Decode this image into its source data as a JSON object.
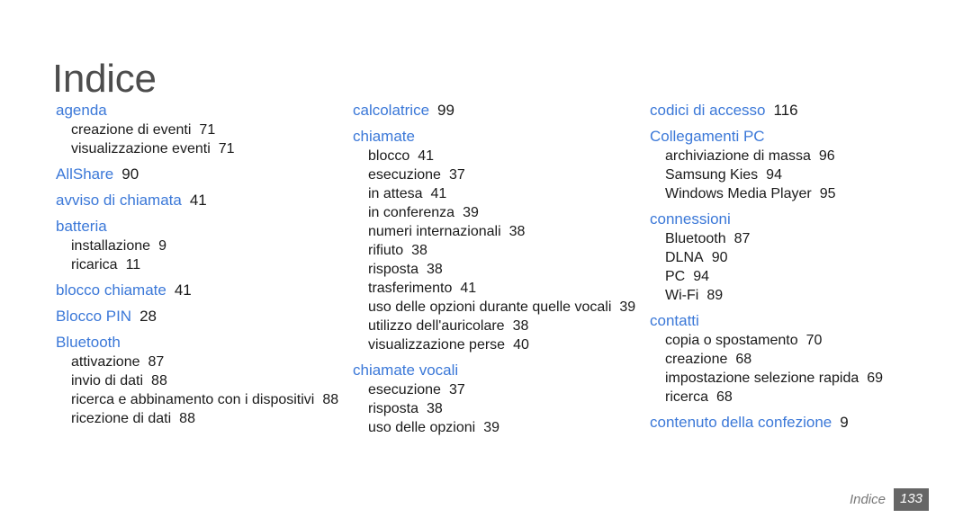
{
  "document": {
    "title": "Indice"
  },
  "footer": {
    "label": "Indice",
    "page_number": "133"
  },
  "colors": {
    "heading": "#3b78d8",
    "body": "#1a1a1a",
    "title": "#4d4d4d",
    "footer_text": "#777777",
    "footer_badge_bg": "#666666",
    "page_background": "#ffffff"
  },
  "columns": [
    {
      "id": "column-1",
      "groups": [
        {
          "heading": "agenda",
          "heading_page": "",
          "subitems": [
            {
              "label": "creazione di eventi",
              "page": "71"
            },
            {
              "label": "visualizzazione eventi",
              "page": "71"
            }
          ]
        },
        {
          "heading": "AllShare",
          "heading_page": "90",
          "subitems": []
        },
        {
          "heading": "avviso di chiamata",
          "heading_page": "41",
          "subitems": []
        },
        {
          "heading": "batteria",
          "heading_page": "",
          "subitems": [
            {
              "label": "installazione",
              "page": "9"
            },
            {
              "label": "ricarica",
              "page": "11"
            }
          ]
        },
        {
          "heading": "blocco chiamate",
          "heading_page": "41",
          "subitems": []
        },
        {
          "heading": "Blocco PIN",
          "heading_page": "28",
          "subitems": []
        },
        {
          "heading": "Bluetooth",
          "heading_page": "",
          "subitems": [
            {
              "label": "attivazione",
              "page": "87"
            },
            {
              "label": "invio di dati",
              "page": "88"
            },
            {
              "label": "ricerca e abbinamento con i dispositivi",
              "page": "88"
            },
            {
              "label": "ricezione di dati",
              "page": "88"
            }
          ]
        }
      ]
    },
    {
      "id": "column-2",
      "groups": [
        {
          "heading": "calcolatrice",
          "heading_page": "99",
          "subitems": []
        },
        {
          "heading": "chiamate",
          "heading_page": "",
          "subitems": [
            {
              "label": "blocco",
              "page": "41"
            },
            {
              "label": "esecuzione",
              "page": "37"
            },
            {
              "label": "in attesa",
              "page": "41"
            },
            {
              "label": "in conferenza",
              "page": "39"
            },
            {
              "label": "numeri internazionali",
              "page": "38"
            },
            {
              "label": "rifiuto",
              "page": "38"
            },
            {
              "label": "risposta",
              "page": "38"
            },
            {
              "label": "trasferimento",
              "page": "41"
            },
            {
              "label": "uso delle opzioni durante quelle vocali",
              "page": "39"
            },
            {
              "label": "utilizzo dell'auricolare",
              "page": "38"
            },
            {
              "label": "visualizzazione perse",
              "page": "40"
            }
          ]
        },
        {
          "heading": "chiamate vocali",
          "heading_page": "",
          "subitems": [
            {
              "label": "esecuzione",
              "page": "37"
            },
            {
              "label": "risposta",
              "page": "38"
            },
            {
              "label": "uso delle opzioni",
              "page": "39"
            }
          ]
        }
      ]
    },
    {
      "id": "column-3",
      "groups": [
        {
          "heading": "codici di accesso",
          "heading_page": "116",
          "subitems": []
        },
        {
          "heading": "Collegamenti PC",
          "heading_page": "",
          "subitems": [
            {
              "label": "archiviazione di massa",
              "page": "96"
            },
            {
              "label": "Samsung Kies",
              "page": "94"
            },
            {
              "label": "Windows Media Player",
              "page": "95"
            }
          ]
        },
        {
          "heading": "connessioni",
          "heading_page": "",
          "subitems": [
            {
              "label": "Bluetooth",
              "page": "87"
            },
            {
              "label": "DLNA",
              "page": "90"
            },
            {
              "label": "PC",
              "page": "94"
            },
            {
              "label": "Wi-Fi",
              "page": "89"
            }
          ]
        },
        {
          "heading": "contatti",
          "heading_page": "",
          "subitems": [
            {
              "label": "copia o spostamento",
              "page": "70"
            },
            {
              "label": "creazione",
              "page": "68"
            },
            {
              "label": "impostazione selezione rapida",
              "page": "69"
            },
            {
              "label": "ricerca",
              "page": "68"
            }
          ]
        },
        {
          "heading": "contenuto della confezione",
          "heading_page": "9",
          "subitems": []
        }
      ]
    }
  ]
}
